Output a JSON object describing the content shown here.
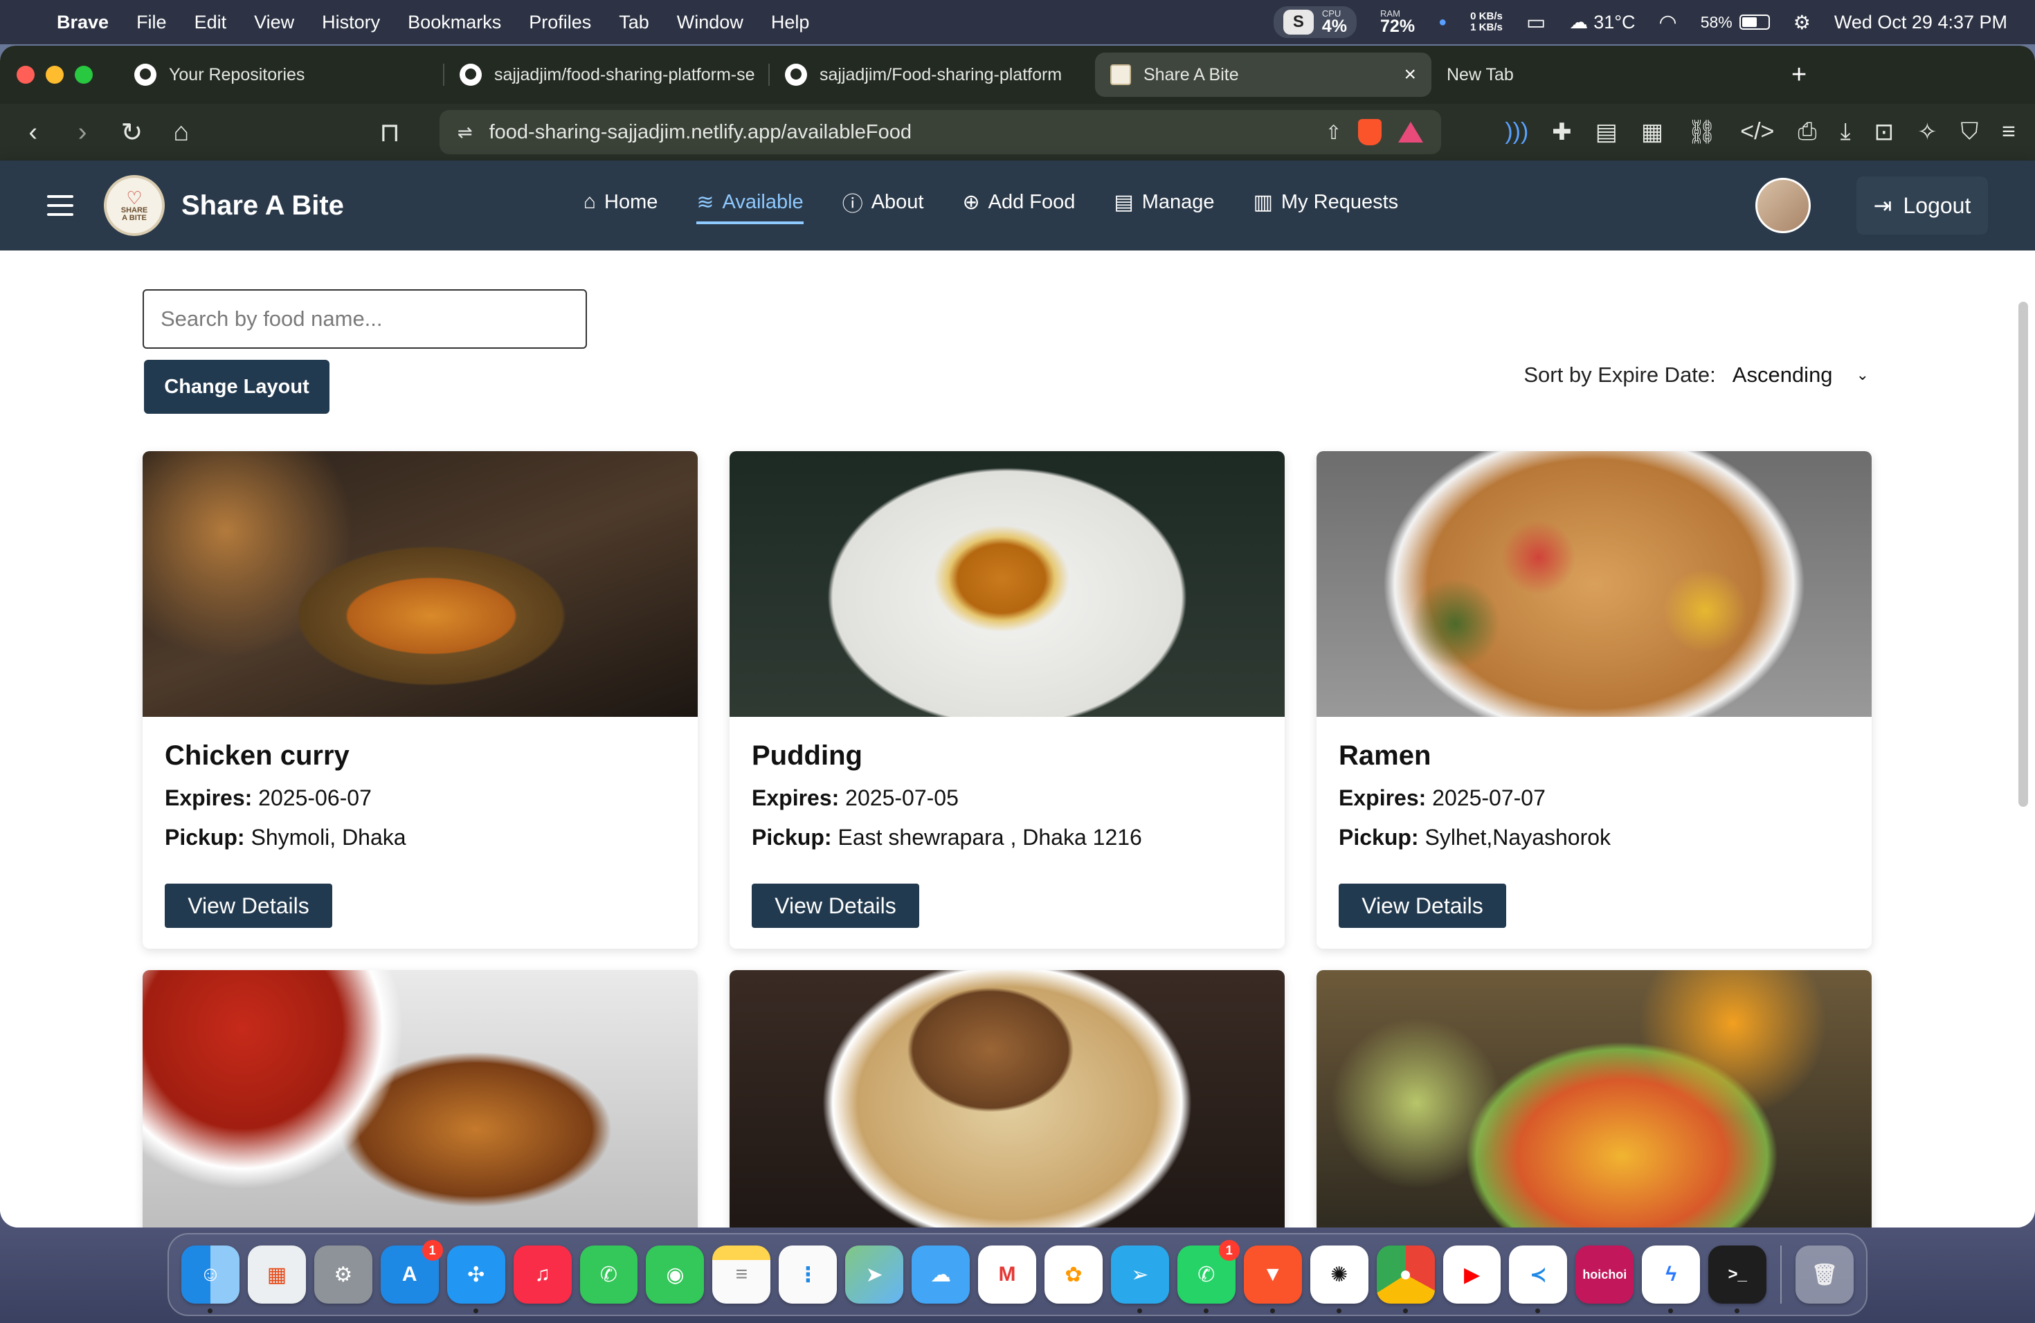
{
  "menubar": {
    "app": "Brave",
    "items": [
      "File",
      "Edit",
      "View",
      "History",
      "Bookmarks",
      "Profiles",
      "Tab",
      "Window",
      "Help"
    ],
    "cpu_label": "CPU",
    "cpu_value": "4%",
    "ram_label": "RAM",
    "ram_value": "72%",
    "net_up": "0 KB/s",
    "net_down": "1 KB/s",
    "weather": "31°C",
    "battery": "58%",
    "battery_level": 0.58,
    "datetime": "Wed Oct 29  4:37 PM"
  },
  "tabs": [
    {
      "title": "Your Repositories",
      "icon": "github-icon"
    },
    {
      "title": "sajjadjim/food-sharing-platform-se",
      "icon": "github-icon"
    },
    {
      "title": "sajjadjim/Food-sharing-platform",
      "icon": "github-icon"
    },
    {
      "title": "Share A Bite",
      "icon": "site-favicon",
      "active": true
    },
    {
      "title": "New Tab",
      "icon": ""
    }
  ],
  "address": {
    "url": "food-sharing-sajjadjim.netlify.app/availableFood"
  },
  "site": {
    "brand": "Share A Bite",
    "logo_text_1": "SHARE",
    "logo_text_2": "A BITE",
    "nav": [
      {
        "label": "Home",
        "icon": "home-icon"
      },
      {
        "label": "Available",
        "icon": "layers-icon",
        "active": true
      },
      {
        "label": "About",
        "icon": "info-icon"
      },
      {
        "label": "Add Food",
        "icon": "plus-circle-icon"
      },
      {
        "label": "Manage",
        "icon": "clipboard-icon"
      },
      {
        "label": "My Requests",
        "icon": "clipboard-list-icon"
      }
    ],
    "logout_label": "Logout"
  },
  "filters": {
    "search_placeholder": "Search by food name...",
    "change_layout_label": "Change Layout",
    "sort_label": "Sort by Expire Date:",
    "sort_value": "Ascending"
  },
  "foods": [
    {
      "name": "Chicken curry",
      "expires_label": "Expires:",
      "expires": "2025-06-07",
      "pickup_label": "Pickup:",
      "pickup": "Shymoli, Dhaka",
      "button": "View Details"
    },
    {
      "name": "Pudding",
      "expires_label": "Expires:",
      "expires": "2025-07-05",
      "pickup_label": "Pickup:",
      "pickup": "East shewrapara , Dhaka 1216",
      "button": "View Details"
    },
    {
      "name": "Ramen",
      "expires_label": "Expires:",
      "expires": "2025-07-07",
      "pickup_label": "Pickup:",
      "pickup": "Sylhet,Nayashorok",
      "button": "View Details"
    }
  ],
  "dock": {
    "app_store_badge": "1",
    "whatsapp_badge": "1",
    "hoichoi_label": "hoichoi"
  }
}
